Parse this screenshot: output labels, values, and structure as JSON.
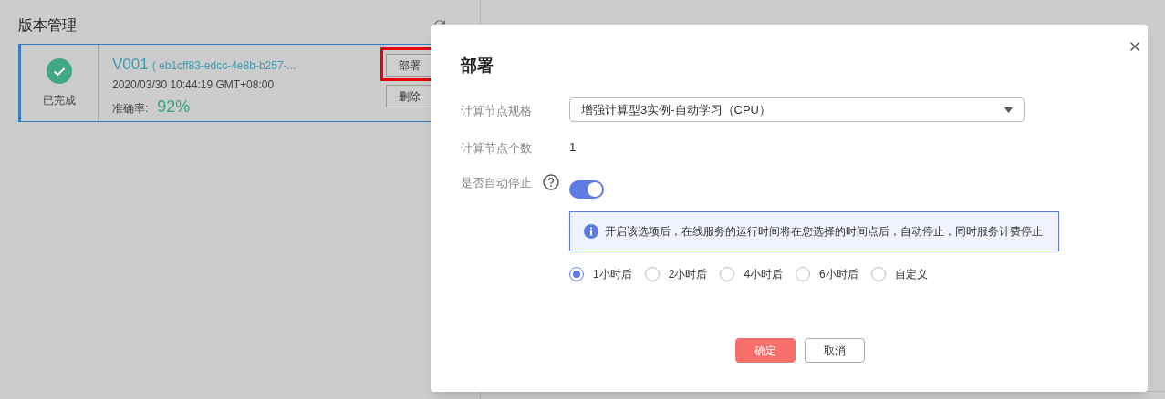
{
  "version_panel": {
    "title": "版本管理",
    "versions": [
      {
        "status": "已完成",
        "done": true,
        "name": "V001",
        "id": "( eb1cff83-edcc-4e8b-b257-...",
        "time": "2020/03/30 10:44:19 GMT+08:00",
        "accuracy_label": "准确率:",
        "accuracy": "92%",
        "selected": true,
        "actions": [
          "部署",
          "删除"
        ]
      }
    ]
  },
  "dialog": {
    "title": "部署",
    "fields": [
      {
        "kind": "select",
        "label": "计算节点规格",
        "value": "增强计算型3实例-自动学习（CPU）"
      },
      {
        "kind": "text",
        "label": "计算节点个数",
        "value": "1"
      },
      {
        "kind": "switch",
        "label": "是否自动停止",
        "on": true,
        "notice": "开启该选项后，在线服务的运行时间将在您选择的时间点后，自动停止，同时服务计费停止",
        "options": [
          {
            "label": "1小时后",
            "selected": true
          },
          {
            "label": "2小时后",
            "selected": false
          },
          {
            "label": "4小时后",
            "selected": false
          },
          {
            "label": "6小时后",
            "selected": false
          },
          {
            "label": "自定义",
            "selected": false
          }
        ]
      }
    ],
    "buttons": [
      {
        "label": "确定",
        "kind": "primary"
      },
      {
        "label": "取消",
        "kind": "secondary"
      }
    ]
  },
  "highlight_first_action": true
}
